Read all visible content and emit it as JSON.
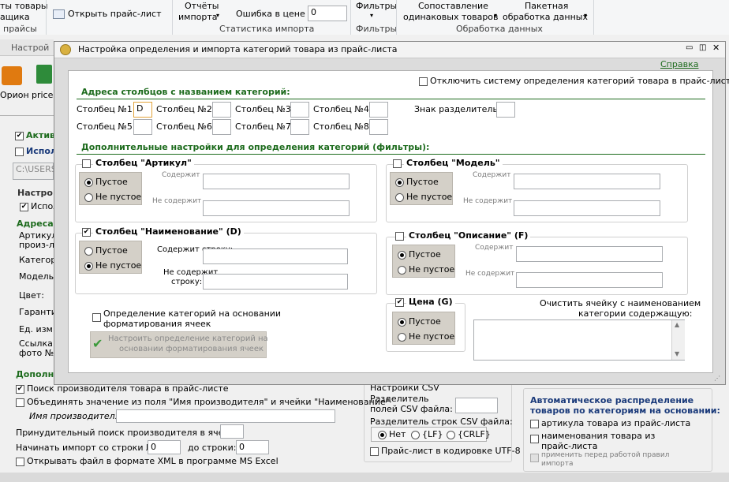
{
  "ribbon": {
    "item_price_goods": "ты товары",
    "item_suppliers": "ащика",
    "group_prices": "прайсы",
    "open_price_list": "Открыть прайс-лист",
    "reports_label_1": "Отчёты",
    "reports_label_2": "импорта",
    "error_in_price_label": "Ошибка в цене",
    "error_in_price_value": "0",
    "group_import_stats": "Статистика импорта",
    "filters_label": "Фильтры",
    "group_filters": "Фильтры",
    "matching_label_1": "Сопоставление",
    "matching_label_2": "одинаковых товаров",
    "batch_label_1": "Пакетная",
    "batch_label_2": "обработка данных",
    "group_data_processing": "Обработка данных"
  },
  "background": {
    "tab_settings": "Настрой",
    "orion": "Орион",
    "price": "price.",
    "active": "Актив",
    "use": "Испол",
    "path": "C:\\USERS",
    "settings_heading": "Настро",
    "use2": "Испол",
    "addresses": "Адреса",
    "article_1": "Артикул",
    "article_2": "произ-ля",
    "category": "Категор",
    "model": "Модель:",
    "color": "Цвет:",
    "warranty": "Гаранти",
    "unit": "Ед. изм:",
    "link_1": "Ссылка",
    "link_2": "фото №",
    "additional": "Дополн",
    "search_manufacturer": "Поиск производителя товара в прайс-листе",
    "combine_values": "Объединять значение из поля \"Имя производителя\" и ячейки \"Наименование\"",
    "manufacturer_name": "Имя производителя:",
    "forced_search": "Принудительный поиск производителя в ячейке:",
    "start_import": "Начинать импорт со строки №:",
    "start_import_value": "0",
    "to_row": "до строки:",
    "to_row_value": "0",
    "open_xml": "Открывать файл в формате XML в программе MS Excel",
    "csv_settings": "Настройки CSV",
    "csv_field_sep_1": "Разделитель",
    "csv_field_sep_2": "полей CSV файла:",
    "csv_row_sep": "Разделитель строк CSV файла:",
    "csv_no": "Нет",
    "csv_lf": "{LF}",
    "csv_crlf": "{CRLF}",
    "utf8": "Прайс-лист в кодировке UTF-8",
    "auto_dist_1": "Автоматическое распределение",
    "auto_dist_2": "товаров по категориям на основании:",
    "auto_article": "артикула товара из прайс-листа",
    "auto_name_1": "наименования товара из",
    "auto_name_2": "прайс-листа",
    "apply_rules_1": "применить перед работой правил",
    "apply_rules_2": "импорта"
  },
  "dialog": {
    "title": "Настройка определения и импорта категорий товара из прайс-листа",
    "help_link": "Справка",
    "disable_system": "Отключить систему определения категорий товара в прайс-листе",
    "section_columns": "Адреса столбцов с названием категорий:",
    "col1": "Столбец №1:",
    "col1_value": "D",
    "col2": "Столбец №2:",
    "col3": "Столбец №3:",
    "col4": "Столбец №4:",
    "col5": "Столбец №5:",
    "col6": "Столбец №6:",
    "col7": "Столбец №7:",
    "col8": "Столбец №8:",
    "separator": "Знак разделитель:",
    "section_filters": "Дополнительные настройки для определения категорий (фильтры):",
    "art_title": "Столбец \"Артикул\"",
    "model_title": "Столбец \"Модель\"",
    "name_title": "Столбец \"Наименование\" (D)",
    "desc_title": "Столбец \"Описание\" (F)",
    "price_title": "Цена (G)",
    "empty": "Пустое",
    "not_empty": "Не пустое",
    "contains": "Содержит",
    "not_contains": "Не содержит",
    "contains_row": "Содержит строку:",
    "not_contains_row_1": "Не содержит",
    "not_contains_row_2": "строку:",
    "format_detect_1": "Определение категорий на основании",
    "format_detect_2": "форматирования ячеек",
    "format_btn_1": "Настроить определение категорий на",
    "format_btn_2": "основании форматирования ячеек",
    "clear_cell_1": "Очистить ячейку с наименованием",
    "clear_cell_2": "категории содержащую:"
  },
  "colors": {
    "accent_green": "#1d6b1d",
    "link_green": "#1d6b1d"
  }
}
